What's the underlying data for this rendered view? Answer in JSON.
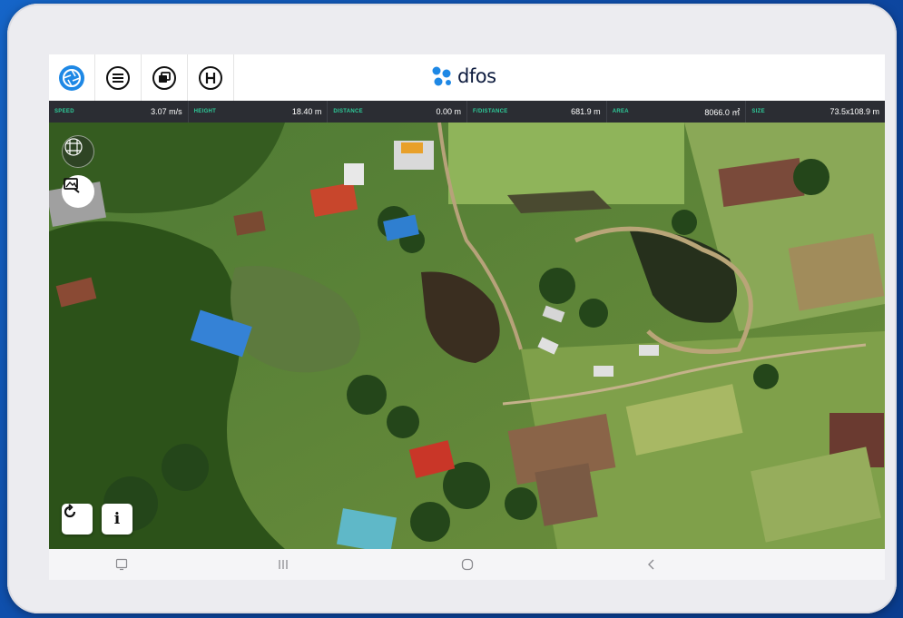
{
  "brand": {
    "name": "dfos"
  },
  "toolbar": {
    "icons": [
      "camera-shutter-icon",
      "menu-list-icon",
      "layers-icon",
      "home-point-icon"
    ]
  },
  "telemetry": [
    {
      "label": "SPEED",
      "value": "3.07 m/s"
    },
    {
      "label": "HEIGHT",
      "value": "18.40 m"
    },
    {
      "label": "DISTANCE",
      "value": "0.00 m"
    },
    {
      "label": "F/DISTANCE",
      "value": "681.9 m"
    },
    {
      "label": "AREA",
      "value": "8066.0 ㎡"
    },
    {
      "label": "SIZE",
      "value": "73.5x108.9 m"
    }
  ],
  "map_controls": {
    "info_label": "i"
  },
  "colors": {
    "accent": "#1e88e5",
    "telemetry_bg": "#2b2d33",
    "telemetry_label": "#2ecc9a"
  }
}
